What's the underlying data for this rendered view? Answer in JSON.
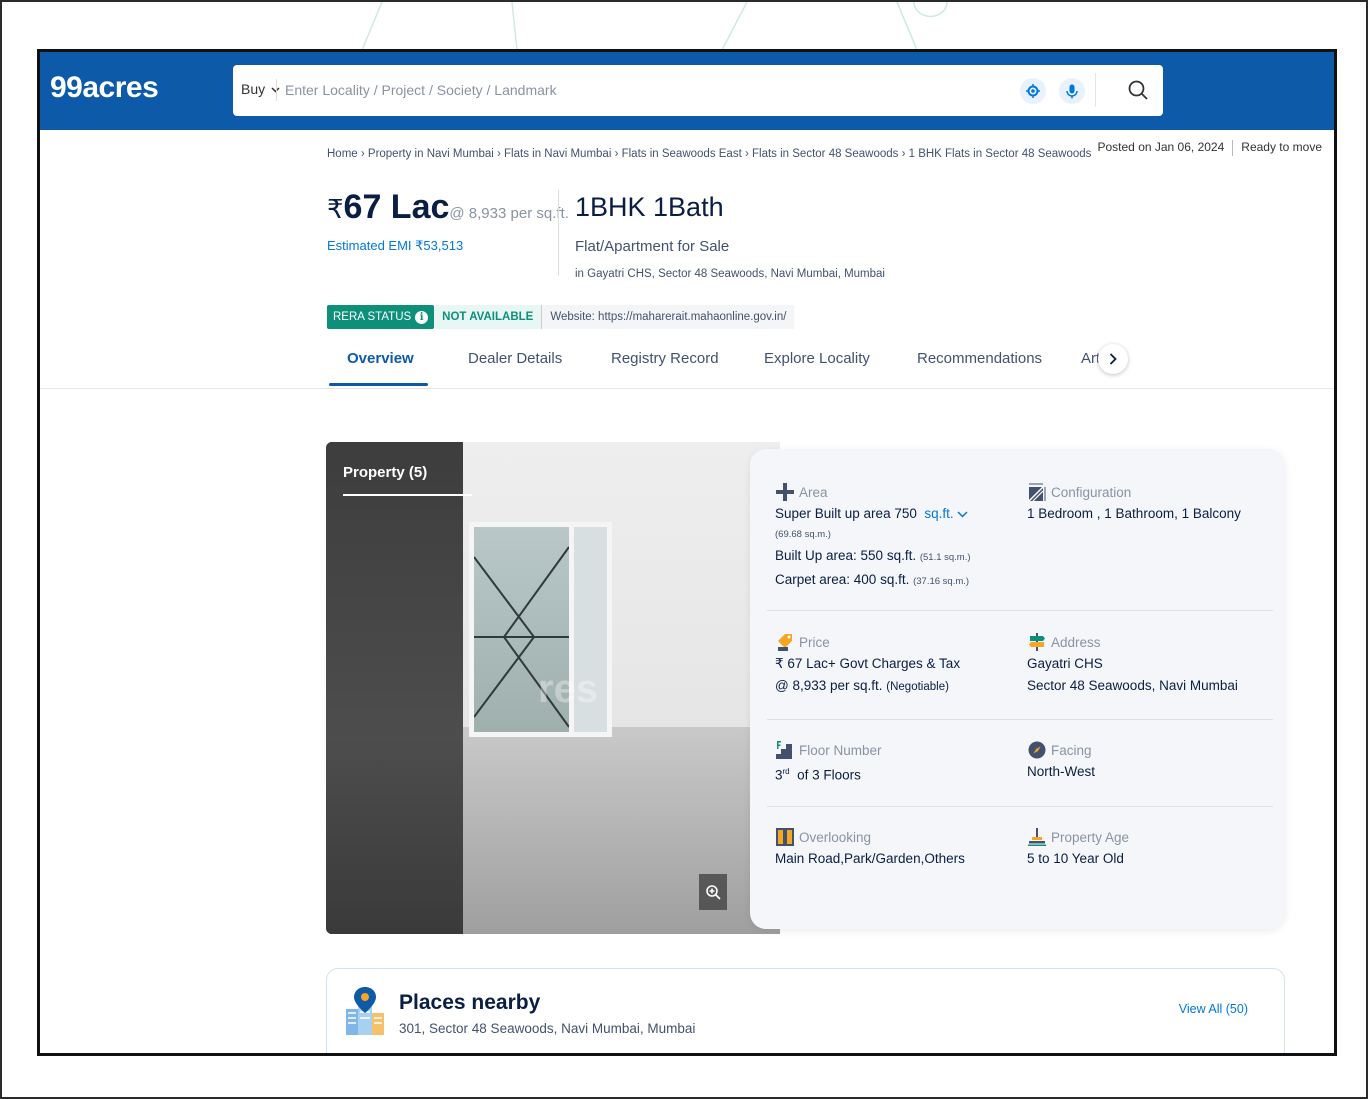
{
  "header": {
    "logo": "99acres",
    "buy_label": "Buy",
    "search_placeholder": "Enter Locality / Project / Society / Landmark"
  },
  "breadcrumb": "Home › Property in Navi Mumbai › Flats in Navi Mumbai › Flats in Seawoods East › Flats in Sector 48 Seawoods › 1 BHK Flats in Sector 48 Seawoods",
  "posted": {
    "date": "Posted on Jan 06, 2024",
    "status": "Ready to move"
  },
  "price": {
    "symbol": "₹",
    "amount": "67 Lac",
    "per_sqft": "@ 8,933 per sq.ft.",
    "emi": "Estimated EMI ₹53,513"
  },
  "listing": {
    "title": "1BHK 1Bath",
    "type": "Flat/Apartment for Sale",
    "location": "in Gayatri CHS, Sector 48 Seawoods, Navi Mumbai, Mumbai"
  },
  "rera": {
    "label": "RERA STATUS",
    "status": "NOT AVAILABLE",
    "website": "Website: https://maharerait.mahaonline.gov.in/"
  },
  "tabs": [
    {
      "label": "Overview"
    },
    {
      "label": "Dealer Details"
    },
    {
      "label": "Registry Record"
    },
    {
      "label": "Explore Locality"
    },
    {
      "label": "Recommendations"
    },
    {
      "label": "Art"
    }
  ],
  "photo": {
    "label": "Property (5)",
    "watermark": "res"
  },
  "details": {
    "area": {
      "label": "Area",
      "super_built": "Super Built up area 750",
      "unit": "sq.ft.",
      "super_built_sqm": "(69.68 sq.m.)",
      "built_up": "Built Up area: 550 sq.ft.",
      "built_up_sqm": "(51.1 sq.m.)",
      "carpet": "Carpet area: 400 sq.ft.",
      "carpet_sqm": "(37.16 sq.m.)"
    },
    "configuration": {
      "label": "Configuration",
      "value": "1 Bedroom , 1 Bathroom, 1 Balcony"
    },
    "price": {
      "label": "Price",
      "line1": "₹ 67 Lac+ Govt Charges & Tax",
      "line2": "@ 8,933 per sq.ft.",
      "negotiable": "(Negotiable)"
    },
    "address": {
      "label": "Address",
      "line1": "Gayatri CHS",
      "line2": "Sector 48 Seawoods, Navi Mumbai"
    },
    "floor": {
      "label": "Floor Number",
      "floor": "3",
      "suffix": "rd",
      "of_floors": "of 3 Floors"
    },
    "facing": {
      "label": "Facing",
      "value": "North-West"
    },
    "overlooking": {
      "label": "Overlooking",
      "value": "Main Road,Park/Garden,Others"
    },
    "age": {
      "label": "Property Age",
      "value": "5 to 10 Year Old"
    }
  },
  "places": {
    "title": "Places nearby",
    "subtitle": "301, Sector 48 Seawoods, Navi Mumbai, Mumbai",
    "view_all": "View All (50)"
  },
  "colors": {
    "brand_blue": "#0c5aa8",
    "link_blue": "#0078db",
    "rera_green": "#0d8f7a"
  }
}
